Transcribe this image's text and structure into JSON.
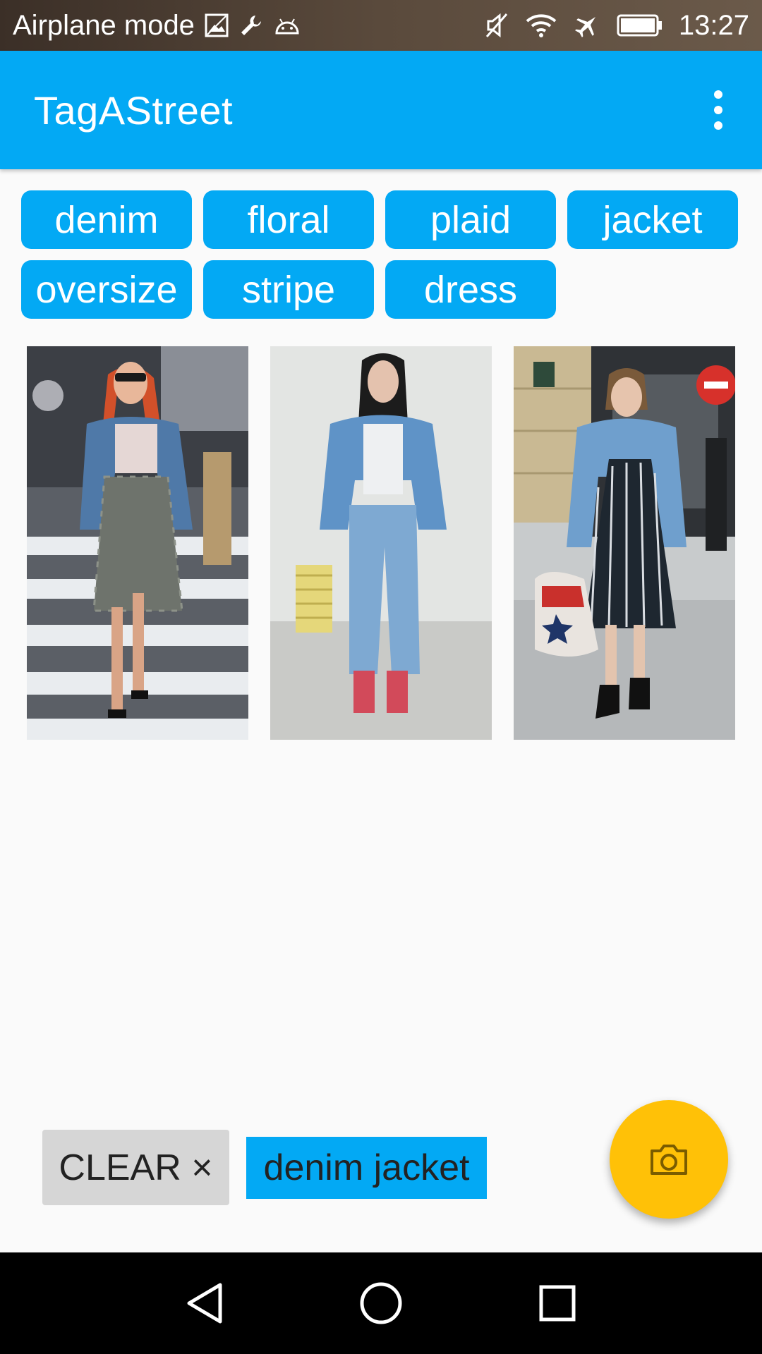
{
  "status_bar": {
    "left_text": "Airplane mode",
    "left_icons": [
      "image-icon",
      "wrench-icon",
      "android-icon"
    ],
    "right_icons": [
      "vibrate-mute-icon",
      "wifi-icon",
      "airplane-icon",
      "battery-icon"
    ],
    "time": "13:27"
  },
  "app_bar": {
    "title": "TagAStreet",
    "menu_icon": "more-vert-icon"
  },
  "tags": [
    "denim",
    "floral",
    "plaid",
    "jacket",
    "oversize",
    "stripe",
    "dress"
  ],
  "bottom": {
    "clear_label": "CLEAR ×",
    "query_text": "denim jacket",
    "fab_icon": "camera-icon"
  },
  "nav_bar": {
    "icons": [
      "back-icon",
      "home-icon",
      "recents-icon"
    ]
  },
  "colors": {
    "primary": "#03a9f4",
    "fab": "#ffc107",
    "background": "#fafafa",
    "clear_button": "#d6d6d6"
  }
}
